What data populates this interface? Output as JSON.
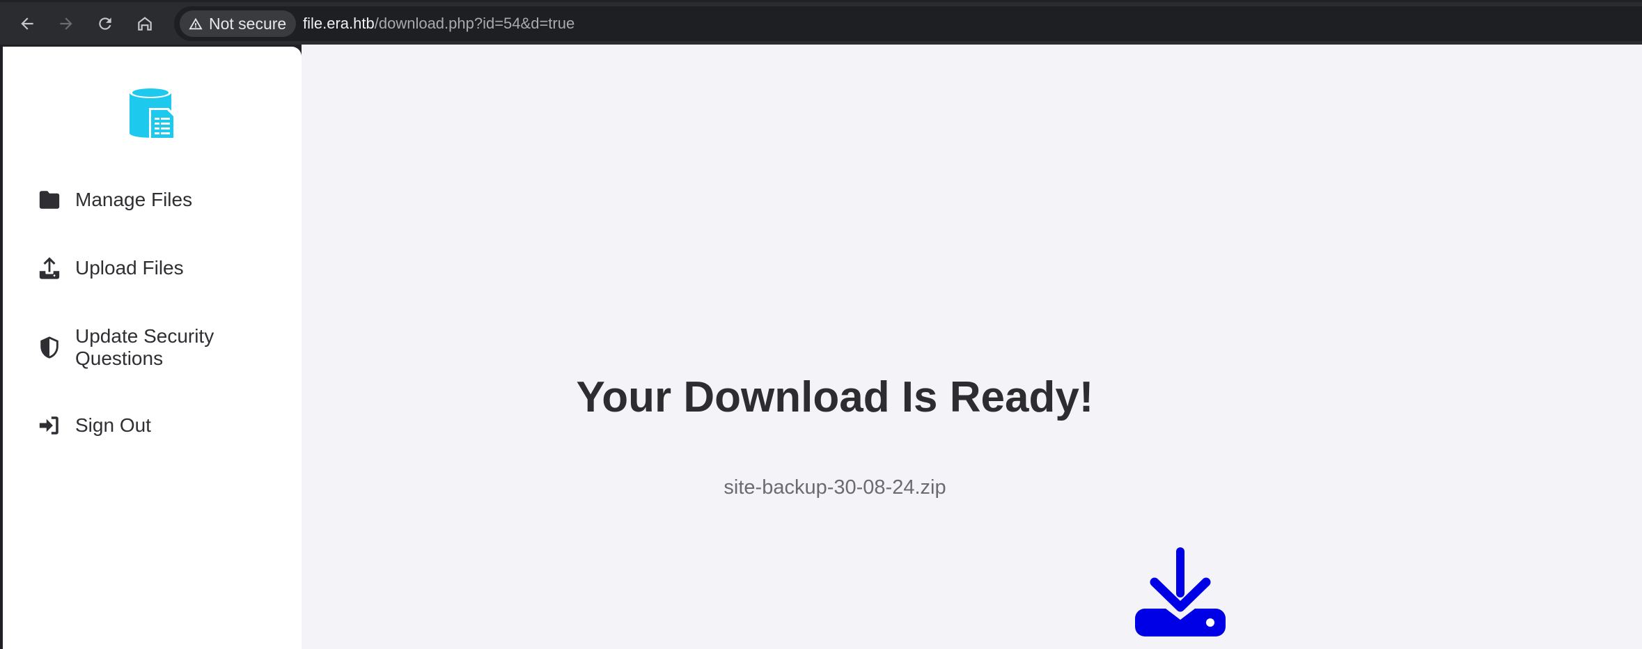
{
  "browser": {
    "security_label": "Not secure",
    "url_host": "file.era.htb",
    "url_path": "/download.php?id=54&d=true"
  },
  "sidebar": {
    "items": [
      {
        "label": "Manage Files",
        "icon": "folder-icon"
      },
      {
        "label": "Upload Files",
        "icon": "upload-icon"
      },
      {
        "label": "Update Security Questions",
        "icon": "shield-icon"
      },
      {
        "label": "Sign Out",
        "icon": "sign-out-icon"
      }
    ]
  },
  "main": {
    "title": "Your Download Is Ready!",
    "file_name": "site-backup-30-08-24.zip"
  },
  "colors": {
    "logo": "#1ec9ee",
    "download_icon": "#0000e6",
    "sidebar_text": "#2f2f33",
    "main_bg": "#f4f4f8"
  }
}
